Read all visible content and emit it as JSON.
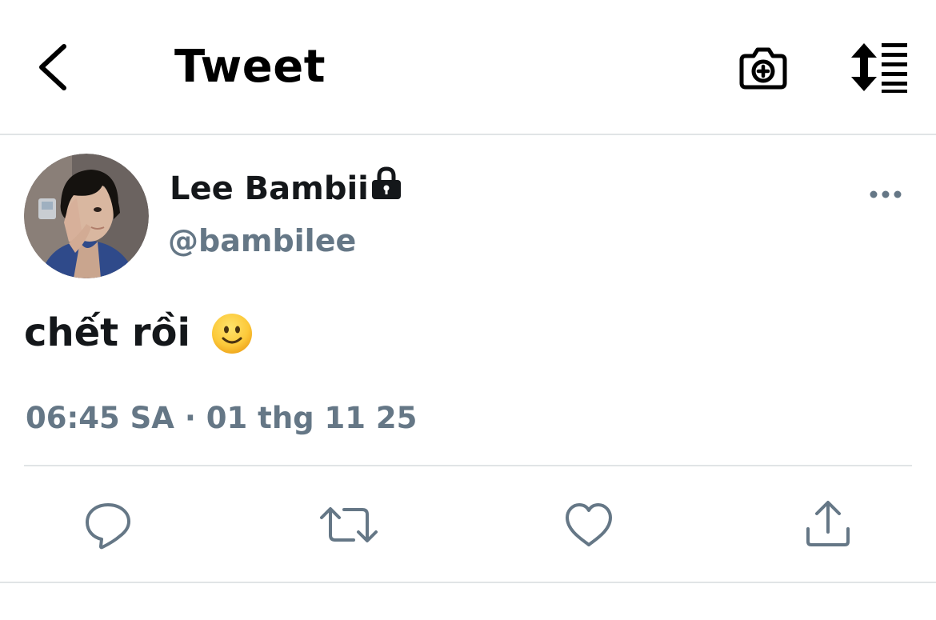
{
  "header": {
    "title": "Tweet",
    "icons": {
      "back": "chevron-left-icon",
      "camera": "camera-plus-icon",
      "sort": "sort-arrows-lines-icon"
    }
  },
  "tweet": {
    "author": {
      "display_name": "Lee Bambii",
      "handle": "@bambilee",
      "protected": true
    },
    "text": "chết rồi",
    "emoji": "slightly-smiling-face",
    "timestamp": "06:45 SA · 01 thg 11 25"
  },
  "actions": [
    {
      "name": "reply",
      "icon": "reply-bubble-icon"
    },
    {
      "name": "retweet",
      "icon": "retweet-icon"
    },
    {
      "name": "like",
      "icon": "heart-icon"
    },
    {
      "name": "share",
      "icon": "share-upload-icon"
    }
  ],
  "colors": {
    "text_primary": "#14171a",
    "text_secondary": "#657786",
    "divider": "#e1e4e6",
    "icon_gray": "#657786",
    "background": "#ffffff"
  }
}
